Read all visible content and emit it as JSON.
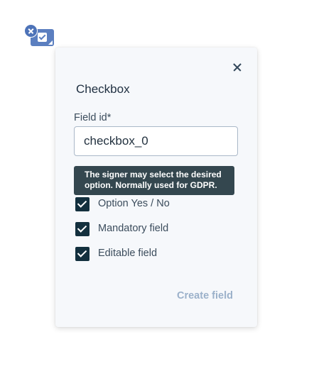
{
  "marker": {
    "type_icon": "checkbox-icon",
    "remove_icon": "close-icon",
    "accent_color": "#5b7fc0"
  },
  "dialog": {
    "title": "Checkbox",
    "close_icon": "close-icon",
    "field_id": {
      "label": "Field id",
      "required_mark": "*",
      "value": "checkbox_0"
    },
    "tooltip": "The signer may select the desired option. Normally used for GDPR.",
    "options": [
      {
        "label": "",
        "checked": false
      },
      {
        "label": "Option Yes / No",
        "checked": true
      },
      {
        "label": "Mandatory field",
        "checked": true
      },
      {
        "label": "Editable field",
        "checked": true
      }
    ],
    "create_label": "Create field",
    "checkbox_color": "#13303e",
    "create_color": "#9bb1ca"
  }
}
